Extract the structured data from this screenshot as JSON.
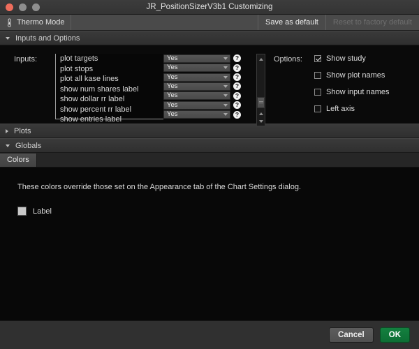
{
  "window": {
    "title": "JR_PositionSizerV3b1 Customizing",
    "traffic_lights": [
      "close",
      "minimize",
      "maximize"
    ]
  },
  "toolbar": {
    "mode_label": "Thermo Mode",
    "mode_icon": "thermometer-icon",
    "save_as_default": "Save as default",
    "reset_to_factory_default": "Reset to factory default",
    "reset_disabled": true
  },
  "sections": {
    "inputs_and_options": {
      "label": "Inputs and Options",
      "expanded": true,
      "caret": "chevron-down-icon"
    },
    "plots": {
      "label": "Plots",
      "expanded": false,
      "caret": "chevron-right-icon"
    },
    "globals": {
      "label": "Globals",
      "expanded": true,
      "caret": "chevron-down-icon"
    }
  },
  "inputs": {
    "label": "Inputs:",
    "rows": [
      {
        "name": "plot targets",
        "value": "Yes",
        "help": "?"
      },
      {
        "name": "plot stops",
        "value": "Yes",
        "help": "?"
      },
      {
        "name": "plot all kase lines",
        "value": "Yes",
        "help": "?"
      },
      {
        "name": "show num shares label",
        "value": "Yes",
        "help": "?"
      },
      {
        "name": "show dollar rr label",
        "value": "Yes",
        "help": "?"
      },
      {
        "name": "show percent rr label",
        "value": "Yes",
        "help": "?"
      },
      {
        "name": "show entries label",
        "value": "Yes",
        "help": "?"
      }
    ],
    "scrollbar": {
      "up_arrow_icon": "caret-up-icon",
      "bottom_up_arrow_icon": "caret-up-icon",
      "bottom_down_arrow_icon": "caret-down-icon",
      "thumb_icon": "scroll-thumb-grip"
    }
  },
  "options": {
    "label": "Options:",
    "items": [
      {
        "label": "Show study",
        "checked": true
      },
      {
        "label": "Show plot names",
        "checked": false
      },
      {
        "label": "Show input names",
        "checked": false
      },
      {
        "label": "Left axis",
        "checked": false
      }
    ]
  },
  "tabs": [
    {
      "label": "Colors",
      "selected": true
    }
  ],
  "colors_pane": {
    "note": "These colors override those set on the Appearance tab of the Chart Settings dialog.",
    "entries": [
      {
        "label": "Label",
        "color": "#c8c8c8"
      }
    ]
  },
  "footer": {
    "cancel_label": "Cancel",
    "ok_label": "OK",
    "ok_color": "#0f7a3c"
  }
}
